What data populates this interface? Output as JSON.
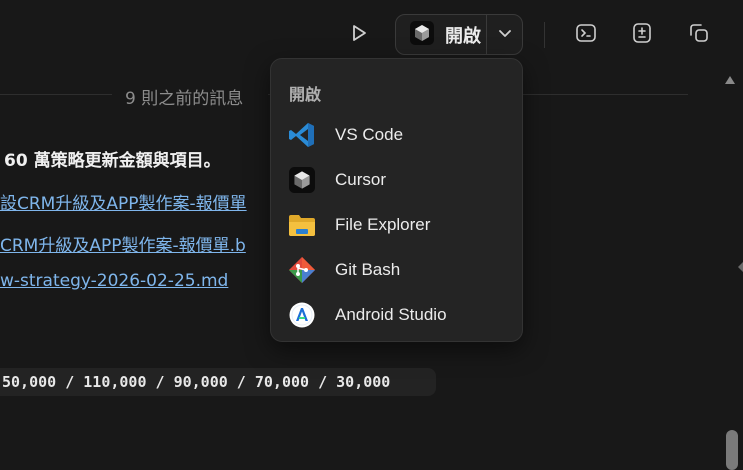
{
  "toolbar": {
    "open_label": "開啟",
    "icons": [
      "play-icon",
      "cursor-app-icon",
      "chevron-down-icon",
      "terminal-icon",
      "diff-icon",
      "copy-window-icon"
    ]
  },
  "thread": {
    "earlier_messages": "9 則之前的訊息",
    "summary": "60 萬策略更新金額與項目。",
    "links": [
      "設CRM升級及APP製作案-報價單",
      "CRM升級及APP製作案-報價單.b",
      "w-strategy-2026-02-25.md"
    ],
    "code": "50,000 / 110,000 / 90,000 / 70,000 / 30,000"
  },
  "menu": {
    "header": "開啟",
    "items": [
      {
        "label": "VS Code",
        "icon": "vscode-icon"
      },
      {
        "label": "Cursor",
        "icon": "cursor-icon"
      },
      {
        "label": "File Explorer",
        "icon": "folder-icon"
      },
      {
        "label": "Git Bash",
        "icon": "git-icon"
      },
      {
        "label": "Android Studio",
        "icon": "android-studio-icon"
      }
    ]
  },
  "colors": {
    "background": "#181818",
    "menu_bg": "#242424",
    "link": "#7fb6ec",
    "vscode_blue": "#2a8bd6",
    "folder_yellow": "#f4c03f",
    "git_red": "#e1493b"
  }
}
